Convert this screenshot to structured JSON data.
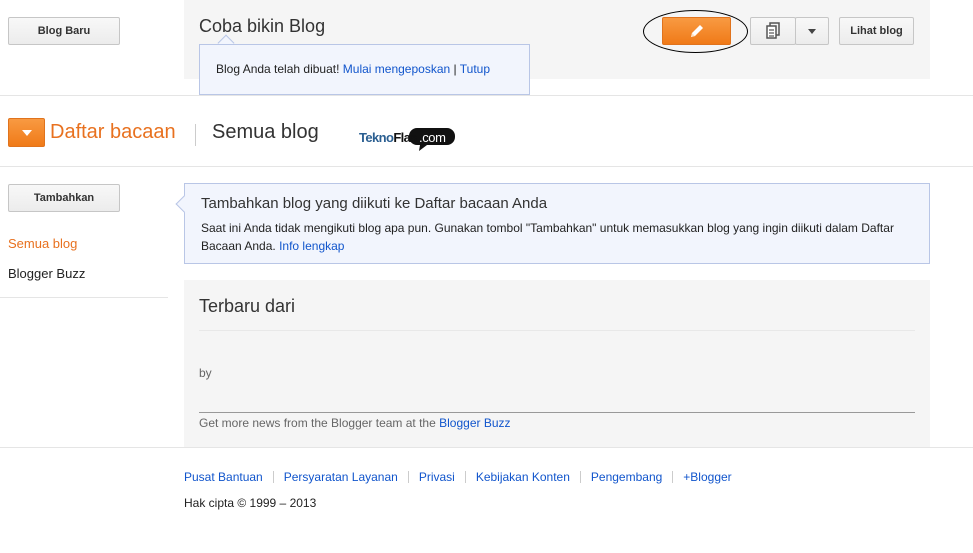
{
  "header": {
    "new_blog_label": "Blog Baru",
    "blog_title": "Coba bikin Blog",
    "view_blog_label": "Lihat blog"
  },
  "notice": {
    "text": "Blog Anda telah dibuat!",
    "start_link": "Mulai mengeposkan",
    "separator": "|",
    "close_link": "Tutup"
  },
  "reading_list": {
    "title": "Daftar bacaan",
    "subtitle": "Semua blog"
  },
  "logo": {
    "text_part1": "TeknoFlas",
    "text_part2": ".com"
  },
  "sidebar": {
    "add_label": "Tambahkan",
    "items": [
      {
        "label": "Semua blog",
        "active": true
      },
      {
        "label": "Blogger Buzz",
        "active": false
      }
    ]
  },
  "info": {
    "title": "Tambahkan blog yang diikuti ke Daftar bacaan Anda",
    "body": "Saat ini Anda tidak mengikuti blog apa pun. Gunakan tombol \"Tambahkan\" untuk memasukkan blog yang ingin diikuti dalam Daftar Bacaan Anda.",
    "more_link": "Info lengkap"
  },
  "latest": {
    "title": "Terbaru dari",
    "by_label": "by",
    "more_text": "Get more news from the Blogger team at the",
    "buzz_link": "Blogger Buzz"
  },
  "footer": {
    "links": [
      "Pusat Bantuan",
      "Persyaratan Layanan",
      "Privasi",
      "Kebijakan Konten",
      "Pengembang",
      "+Blogger"
    ],
    "copyright": "Hak cipta © 1999 – 2013"
  },
  "colors": {
    "accent_orange": "#f07a18",
    "link_blue": "#1155cc",
    "info_bg": "#f2f5fd"
  },
  "icons": {
    "edit": "pencil-icon",
    "posts": "document-copy-icon",
    "dropdown": "chevron-down-icon"
  }
}
